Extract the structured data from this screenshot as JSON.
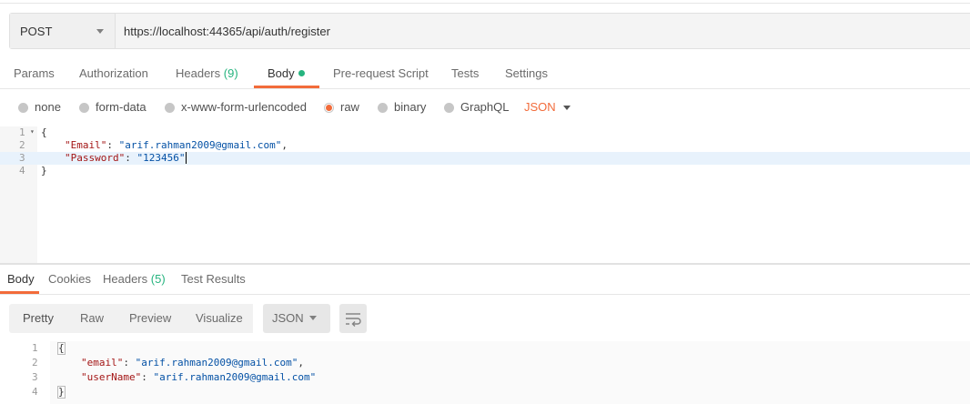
{
  "request": {
    "method": "POST",
    "url": "https://localhost:44365/api/auth/register"
  },
  "request_tabs": [
    {
      "label": "Params"
    },
    {
      "label": "Authorization"
    },
    {
      "label": "Headers",
      "count": "(9)"
    },
    {
      "label": "Body"
    },
    {
      "label": "Pre-request Script"
    },
    {
      "label": "Tests"
    },
    {
      "label": "Settings"
    }
  ],
  "body_types": {
    "none": "none",
    "form_data": "form-data",
    "urlencoded": "x-www-form-urlencoded",
    "raw": "raw",
    "binary": "binary",
    "graphql": "GraphQL",
    "format": "JSON"
  },
  "request_body": {
    "lines": [
      "1",
      "2",
      "3",
      "4"
    ],
    "open": "{",
    "close": "}",
    "email_key": "\"Email\"",
    "email_value": "\"arif.rahman2009@gmail.com\"",
    "password_key": "\"Password\"",
    "password_value": "\"123456\""
  },
  "response_tabs": [
    {
      "label": "Body"
    },
    {
      "label": "Cookies"
    },
    {
      "label": "Headers",
      "count": "(5)"
    },
    {
      "label": "Test Results"
    }
  ],
  "response_toolbar": {
    "pretty": "Pretty",
    "raw": "Raw",
    "preview": "Preview",
    "visualize": "Visualize",
    "format": "JSON"
  },
  "response_body": {
    "lines": [
      "1",
      "2",
      "3",
      "4"
    ],
    "open": "{",
    "close": "}",
    "email_key": "\"email\"",
    "email_value": "\"arif.rahman2009@gmail.com\"",
    "username_key": "\"userName\"",
    "username_value": "\"arif.rahman2009@gmail.com\""
  },
  "colors": {
    "accent": "#f26b3a",
    "green": "#26b47f",
    "highlight": "#e8f2fc"
  }
}
